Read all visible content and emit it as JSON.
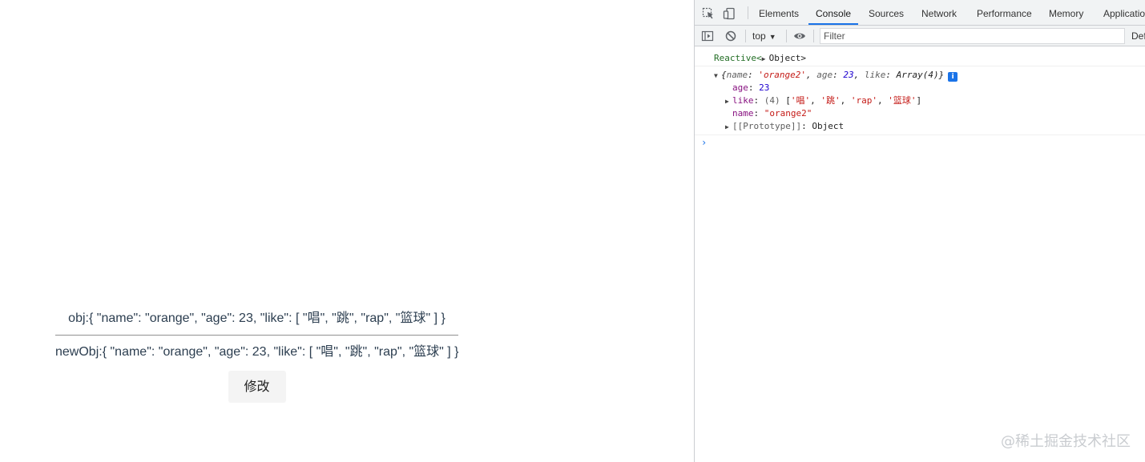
{
  "page": {
    "obj_text": "obj:{ \"name\": \"orange\", \"age\": 23, \"like\": [ \"唱\", \"跳\", \"rap\", \"篮球\" ] }",
    "newobj_text": "newObj:{ \"name\": \"orange\", \"age\": 23, \"like\": [ \"唱\", \"跳\", \"rap\", \"篮球\" ] }",
    "button_label": "修改"
  },
  "devtools": {
    "tabs": [
      "Elements",
      "Console",
      "Sources",
      "Network",
      "Performance",
      "Memory",
      "Application"
    ],
    "active_tab": "Console",
    "toolbar": {
      "context": "top",
      "filter_placeholder": "Filter",
      "default_levels": "Default levels"
    },
    "console": {
      "reactive_prefix": "Reactive<",
      "reactive_object": "Object",
      "reactive_suffix": ">",
      "preview_open": "{",
      "preview_name_key": "name",
      "preview_name_val": "'orange2'",
      "preview_age_key": "age",
      "preview_age_val": "23",
      "preview_like_key": "like",
      "preview_like_val": "Array(4)",
      "preview_close": "}",
      "preview_sep": ", ",
      "preview_colon": ": ",
      "info_badge": "i",
      "age_key": "age",
      "age_val": "23",
      "like_key": "like",
      "like_count": "(4)",
      "like_items": [
        "'唱'",
        "'跳'",
        "'rap'",
        "'篮球'"
      ],
      "name_key": "name",
      "name_val": "\"orange2\"",
      "proto_key": "[[Prototype]]",
      "proto_val": "Object",
      "prompt": "›"
    }
  },
  "watermark": "@稀土掘金技术社区",
  "colors": {
    "accent": "#1a73e8",
    "page_text": "#2c3e50",
    "console_purple": "#881280",
    "console_number": "#1c00cf",
    "console_string": "#c41a16",
    "console_green": "#236e25"
  }
}
